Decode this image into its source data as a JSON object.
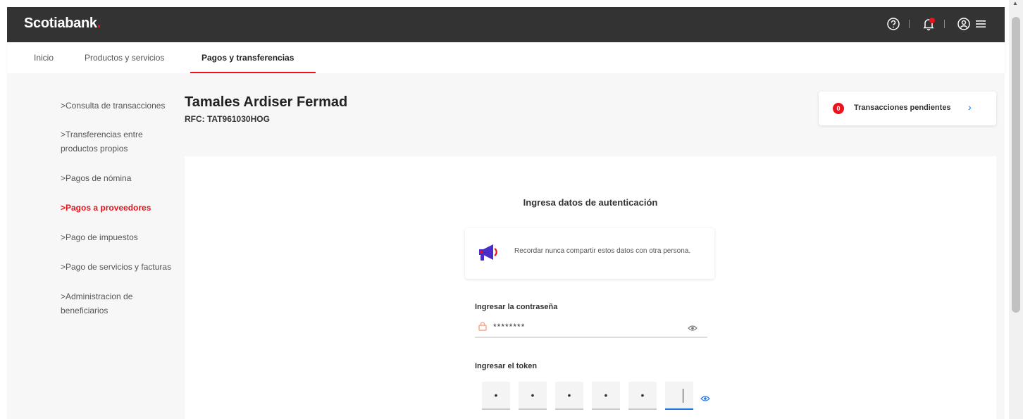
{
  "header": {
    "brand": "Scotiabank",
    "brand_dot": ".",
    "icons": [
      "help-circle-icon",
      "bell-icon",
      "user-circle-icon",
      "menu-icon"
    ]
  },
  "nav": {
    "tabs": [
      {
        "label": "Inicio"
      },
      {
        "label": "Productos y servicios"
      },
      {
        "label": "Pagos y transferencias",
        "active": true
      }
    ]
  },
  "sidebar": {
    "items": [
      {
        "label": ">Consulta de transacciones"
      },
      {
        "label": ">Transferencias entre productos propios"
      },
      {
        "label": ">Pagos de nómina"
      },
      {
        "label": ">Pagos a proveedores",
        "active": true
      },
      {
        "label": ">Pago de impuestos"
      },
      {
        "label": ">Pago de servicios y facturas"
      },
      {
        "label": ">Administracion de beneficiarios"
      }
    ]
  },
  "customer": {
    "name": "Tamales Ardiser Fermad",
    "rfc": "RFC: TAT961030HOG"
  },
  "pending": {
    "count": "0",
    "label": "Transacciones pendientes",
    "chevron": "›"
  },
  "auth": {
    "title": "Ingresa datos de autenticación",
    "notice": "Recordar nunca compartir estos datos con otra persona.",
    "password_label": "Ingresar la contraseña",
    "password_value": "********",
    "token_label": "Ingresar el token",
    "token_digits": [
      "•",
      "•",
      "•",
      "•",
      "•",
      ""
    ]
  },
  "colors": {
    "brand_red": "#ec111a",
    "header_bg": "#333333",
    "focus_blue": "#1a73e8"
  }
}
